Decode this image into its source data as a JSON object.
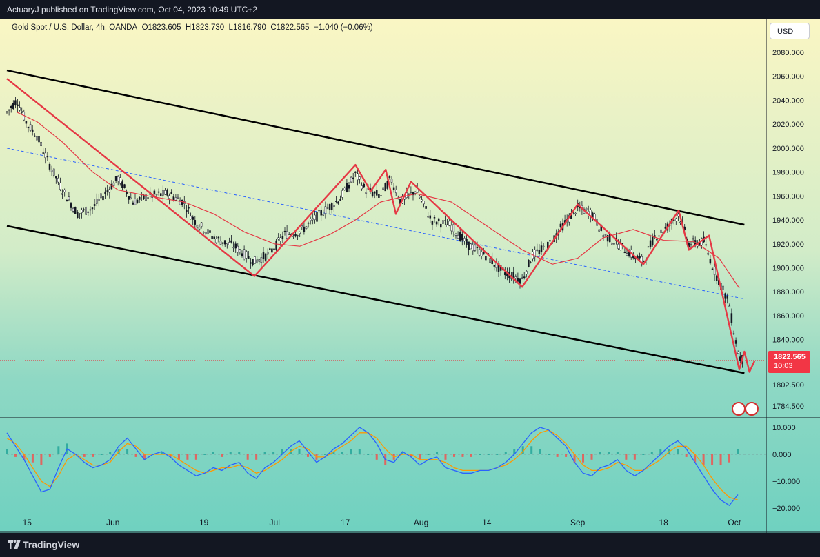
{
  "header": {
    "published_text": "ActuaryJ published on TradingView.com, Oct 04, 2023 10:49 UTC+2"
  },
  "legend": {
    "symbol": "Gold Spot / U.S. Dollar, 4h, OANDA",
    "open": "O1823.605",
    "high": "H1823.730",
    "low": "L1816.790",
    "close": "C1822.565",
    "change": "−1.040 (−0.06%)"
  },
  "currency_button": "USD",
  "last_price": {
    "price": "1822.565",
    "countdown": "10:03",
    "color": "#f23645"
  },
  "footer": {
    "brand": "TradingView"
  },
  "colors": {
    "channel": "#000000",
    "midline": "#2962ff",
    "zigzag": "#e53945",
    "ma": "#e53945",
    "macd": "#2962ff",
    "signal": "#ff9800",
    "hist_pos": "#26a69a",
    "hist_neg": "#ef5350"
  },
  "chart_data": [
    {
      "type": "candlestick",
      "symbol": "XAU/USD",
      "timeframe": "4h",
      "x_ticks": [
        "15",
        "Jun",
        "19",
        "Jul",
        "17",
        "Aug",
        "14",
        "Sep",
        "18",
        "Oct"
      ],
      "y_ticks": [
        "2080.000",
        "2060.000",
        "2040.000",
        "2020.000",
        "2000.000",
        "1980.000",
        "1960.000",
        "1940.000",
        "1920.000",
        "1900.000",
        "1880.000",
        "1860.000",
        "1840.000",
        "1802.500",
        "1784.500"
      ],
      "ylim": [
        1781,
        2100
      ],
      "price_path": [
        {
          "x": "May 11",
          "y": 2030
        },
        {
          "x": "May 13",
          "y": 2040
        },
        {
          "x": "May 15",
          "y": 2020
        },
        {
          "x": "May 17",
          "y": 2010
        },
        {
          "x": "May 19",
          "y": 1990
        },
        {
          "x": "May 22",
          "y": 1965
        },
        {
          "x": "May 25",
          "y": 1945
        },
        {
          "x": "May 28",
          "y": 1950
        },
        {
          "x": "May 31",
          "y": 1965
        },
        {
          "x": "Jun 2",
          "y": 1975
        },
        {
          "x": "Jun 5",
          "y": 1955
        },
        {
          "x": "Jun 8",
          "y": 1960
        },
        {
          "x": "Jun 12",
          "y": 1962
        },
        {
          "x": "Jun 15",
          "y": 1955
        },
        {
          "x": "Jun 17",
          "y": 1940
        },
        {
          "x": "Jun 21",
          "y": 1925
        },
        {
          "x": "Jun 25",
          "y": 1918
        },
        {
          "x": "Jun 29",
          "y": 1905
        },
        {
          "x": "Jul 2",
          "y": 1912
        },
        {
          "x": "Jul 5",
          "y": 1928
        },
        {
          "x": "Jul 8",
          "y": 1930
        },
        {
          "x": "Jul 12",
          "y": 1945
        },
        {
          "x": "Jul 16",
          "y": 1958
        },
        {
          "x": "Jul 19",
          "y": 1978
        },
        {
          "x": "Jul 21",
          "y": 1965
        },
        {
          "x": "Jul 24",
          "y": 1960
        },
        {
          "x": "Jul 26",
          "y": 1975
        },
        {
          "x": "Jul 28",
          "y": 1955
        },
        {
          "x": "Jul 31",
          "y": 1965
        },
        {
          "x": "Aug 3",
          "y": 1940
        },
        {
          "x": "Aug 7",
          "y": 1935
        },
        {
          "x": "Aug 10",
          "y": 1920
        },
        {
          "x": "Aug 14",
          "y": 1910
        },
        {
          "x": "Aug 17",
          "y": 1897
        },
        {
          "x": "Aug 21",
          "y": 1890
        },
        {
          "x": "Aug 23",
          "y": 1910
        },
        {
          "x": "Aug 26",
          "y": 1918
        },
        {
          "x": "Aug 29",
          "y": 1935
        },
        {
          "x": "Sep 1",
          "y": 1950
        },
        {
          "x": "Sep 4",
          "y": 1945
        },
        {
          "x": "Sep 6",
          "y": 1928
        },
        {
          "x": "Sep 9",
          "y": 1920
        },
        {
          "x": "Sep 12",
          "y": 1910
        },
        {
          "x": "Sep 14",
          "y": 1905
        },
        {
          "x": "Sep 16",
          "y": 1925
        },
        {
          "x": "Sep 19",
          "y": 1935
        },
        {
          "x": "Sep 21",
          "y": 1945
        },
        {
          "x": "Sep 23",
          "y": 1920
        },
        {
          "x": "Sep 26",
          "y": 1922
        },
        {
          "x": "Sep 28",
          "y": 1898
        },
        {
          "x": "Oct 1",
          "y": 1870
        },
        {
          "x": "Oct 2",
          "y": 1845
        },
        {
          "x": "Oct 3",
          "y": 1825
        },
        {
          "x": "Oct 4",
          "y": 1822.565
        }
      ],
      "moving_average": [
        {
          "x": "May 13",
          "y": 2030
        },
        {
          "x": "May 17",
          "y": 2022
        },
        {
          "x": "May 22",
          "y": 2005
        },
        {
          "x": "May 28",
          "y": 1980
        },
        {
          "x": "Jun 2",
          "y": 1965
        },
        {
          "x": "Jun 8",
          "y": 1960
        },
        {
          "x": "Jun 15",
          "y": 1955
        },
        {
          "x": "Jun 21",
          "y": 1945
        },
        {
          "x": "Jun 27",
          "y": 1930
        },
        {
          "x": "Jul 3",
          "y": 1920
        },
        {
          "x": "Jul 8",
          "y": 1918
        },
        {
          "x": "Jul 14",
          "y": 1928
        },
        {
          "x": "Jul 19",
          "y": 1940
        },
        {
          "x": "Jul 24",
          "y": 1955
        },
        {
          "x": "Jul 31",
          "y": 1962
        },
        {
          "x": "Aug 7",
          "y": 1955
        },
        {
          "x": "Aug 14",
          "y": 1935
        },
        {
          "x": "Aug 21",
          "y": 1915
        },
        {
          "x": "Aug 27",
          "y": 1903
        },
        {
          "x": "Sep 1",
          "y": 1908
        },
        {
          "x": "Sep 6",
          "y": 1925
        },
        {
          "x": "Sep 12",
          "y": 1932
        },
        {
          "x": "Sep 18",
          "y": 1923
        },
        {
          "x": "Sep 24",
          "y": 1922
        },
        {
          "x": "Sep 29",
          "y": 1908
        },
        {
          "x": "Oct 3",
          "y": 1883
        }
      ],
      "zigzag": [
        {
          "x": "May 11",
          "y": 2058
        },
        {
          "x": "Jun 29",
          "y": 1893
        },
        {
          "x": "Jul 19",
          "y": 1986
        },
        {
          "x": "Jul 22",
          "y": 1964
        },
        {
          "x": "Jul 25",
          "y": 1982
        },
        {
          "x": "Jul 27",
          "y": 1945
        },
        {
          "x": "Jul 30",
          "y": 1972
        },
        {
          "x": "Aug 21",
          "y": 1884
        },
        {
          "x": "Sep 1",
          "y": 1953
        },
        {
          "x": "Sep 14",
          "y": 1903
        },
        {
          "x": "Sep 21",
          "y": 1948
        },
        {
          "x": "Sep 23",
          "y": 1915
        },
        {
          "x": "Sep 27",
          "y": 1927
        },
        {
          "x": "Oct 3",
          "y": 1815
        },
        {
          "x": "Oct 4",
          "y": 1830
        },
        {
          "x": "Oct 5",
          "y": 1813
        },
        {
          "x": "Oct 6",
          "y": 1822
        }
      ],
      "channel": {
        "upper": [
          {
            "x": "May 11",
            "y": 2065
          },
          {
            "x": "Oct 4",
            "y": 1936
          }
        ],
        "lower": [
          {
            "x": "May 11",
            "y": 1935
          },
          {
            "x": "Oct 4",
            "y": 1812
          }
        ],
        "mid": [
          {
            "x": "May 11",
            "y": 2000
          },
          {
            "x": "Oct 4",
            "y": 1874
          }
        ]
      },
      "current_price": 1822.565
    },
    {
      "type": "line",
      "indicator": "MACD",
      "y_ticks": [
        "10.000",
        "0.000",
        "−10.000",
        "−20.000"
      ],
      "ylim": [
        -22,
        12
      ],
      "series": [
        {
          "values": [
            8,
            3,
            -2,
            -8,
            -14,
            -13,
            -5,
            2,
            0,
            -3,
            -5,
            -4,
            -2,
            3,
            6,
            2,
            -2,
            0,
            1,
            -1,
            -4,
            -6,
            -8,
            -7,
            -5,
            -6,
            -4,
            -3,
            -7,
            -9,
            -5,
            -3,
            0,
            3,
            5,
            1,
            -3,
            -1,
            2,
            4,
            7,
            10,
            8,
            4,
            -2,
            -3,
            1,
            -1,
            -4,
            -2,
            -1,
            -5,
            -6,
            -7,
            -7,
            -6,
            -6,
            -5,
            -3,
            0,
            4,
            8,
            10,
            9,
            6,
            3,
            -3,
            -7,
            -8,
            -5,
            -4,
            -2,
            -6,
            -8,
            -6,
            -3,
            0,
            3,
            5,
            2,
            -3,
            -8,
            -13,
            -17,
            -19,
            -15
          ]
        },
        {
          "values": [
            6,
            4,
            0,
            -5,
            -10,
            -12,
            -8,
            -2,
            0,
            -2,
            -4,
            -4,
            -3,
            1,
            4,
            3,
            0,
            0,
            0,
            0,
            -2,
            -4,
            -6,
            -7,
            -6,
            -5,
            -5,
            -4,
            -5,
            -7,
            -6,
            -4,
            -2,
            1,
            3,
            2,
            -1,
            -1,
            1,
            3,
            5,
            8,
            8,
            6,
            2,
            -1,
            0,
            0,
            -2,
            -2,
            -2,
            -3,
            -5,
            -6,
            -6,
            -6,
            -6,
            -5,
            -4,
            -2,
            1,
            5,
            8,
            9,
            7,
            4,
            0,
            -4,
            -6,
            -6,
            -5,
            -3,
            -4,
            -6,
            -6,
            -4,
            -2,
            1,
            3,
            3,
            0,
            -4,
            -9,
            -13,
            -16,
            -17
          ]
        },
        {
          "values": [
            2,
            -1,
            -2,
            -3,
            -4,
            -1,
            3,
            4,
            0,
            -1,
            -1,
            0,
            1,
            2,
            2,
            -1,
            -2,
            0,
            1,
            -1,
            -2,
            -2,
            -2,
            0,
            1,
            -1,
            1,
            1,
            -2,
            -2,
            1,
            1,
            2,
            2,
            2,
            -1,
            -2,
            0,
            1,
            1,
            2,
            2,
            0,
            -2,
            -4,
            -2,
            1,
            -1,
            -2,
            0,
            1,
            -2,
            -1,
            -1,
            -1,
            0,
            0,
            0,
            1,
            2,
            3,
            3,
            2,
            0,
            -1,
            -1,
            -3,
            -3,
            -2,
            1,
            1,
            1,
            -2,
            -2,
            0,
            1,
            2,
            2,
            2,
            -1,
            -3,
            -4,
            -4,
            -4,
            -3,
            2
          ]
        }
      ]
    }
  ]
}
